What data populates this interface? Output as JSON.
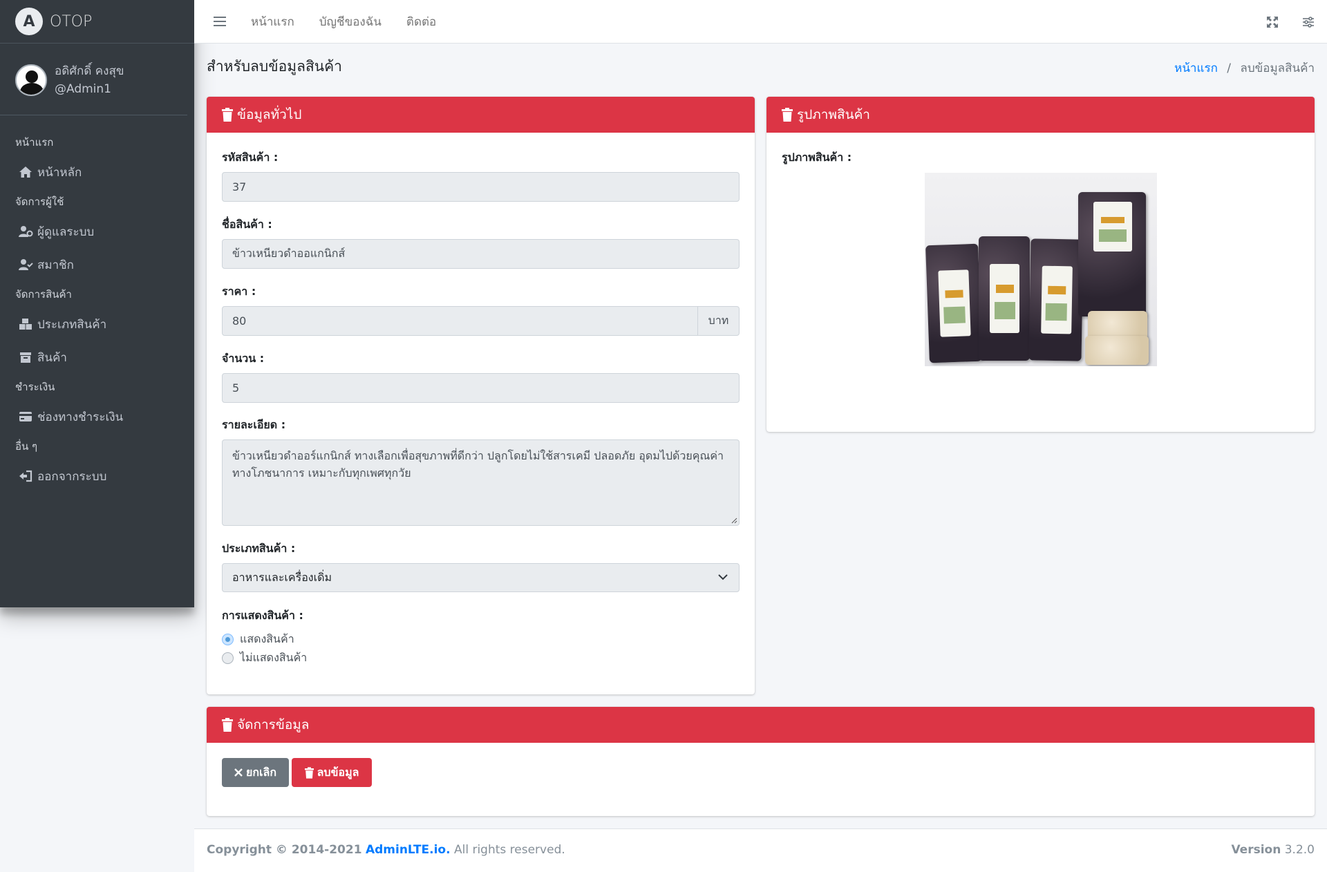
{
  "brand": {
    "logo_letter": "A",
    "name": "OTOP"
  },
  "user": {
    "name": "อดิศักดิ์ คงสุข",
    "handle": "@Admin1"
  },
  "sidebar": {
    "sections": [
      {
        "header": "หน้าแรก",
        "items": [
          {
            "label": "หน้าหลัก",
            "icon": "home-icon"
          }
        ]
      },
      {
        "header": "จัดการผู้ใช้",
        "items": [
          {
            "label": "ผู้ดูแลระบบ",
            "icon": "user-cog-icon"
          },
          {
            "label": "สมาชิก",
            "icon": "user-check-icon"
          }
        ]
      },
      {
        "header": "จัดการสินค้า",
        "items": [
          {
            "label": "ประเภทสินค้า",
            "icon": "boxes-icon"
          },
          {
            "label": "สินค้า",
            "icon": "archive-icon"
          }
        ]
      },
      {
        "header": "ชำระเงิน",
        "items": [
          {
            "label": "ช่องทางชำระเงิน",
            "icon": "credit-card-icon"
          }
        ]
      },
      {
        "header": "อื่น ๆ",
        "items": [
          {
            "label": "ออกจากระบบ",
            "icon": "sign-out-icon"
          }
        ]
      }
    ]
  },
  "topbar": {
    "links": [
      "หน้าแรก",
      "บัญชีของฉัน",
      "ติดต่อ"
    ]
  },
  "page": {
    "title": "สำหรับลบข้อมูลสินค้า",
    "breadcrumb_home": "หน้าแรก",
    "breadcrumb_sep": "/",
    "breadcrumb_current": "ลบข้อมูลสินค้า"
  },
  "general_card": {
    "title": "ข้อมูลทั่วไป",
    "code_label": "รหัสสินค้า :",
    "code_value": "37",
    "name_label": "ชื่อสินค้า :",
    "name_value": "ข้าวเหนียวดำออแกนิกส์",
    "price_label": "ราคา :",
    "price_value": "80",
    "price_unit": "บาท",
    "qty_label": "จำนวน :",
    "qty_value": "5",
    "detail_label": "รายละเอียด :",
    "detail_value": "ข้าวเหนียวดำออร์แกนิกส์ ทางเลือกเพื่อสุขภาพที่ดีกว่า ปลูกโดยไม่ใช้สารเคมี ปลอดภัย อุดมไปด้วยคุณค่าทางโภชนาการ เหมาะกับทุกเพศทุกวัย",
    "category_label": "ประเภทสินค้า :",
    "category_value": "อาหารและเครื่องเดิ่ม",
    "display_label": "การแสดงสินค้า :",
    "display_options": [
      "แสดงสินค้า",
      "ไม่แสดงสินค้า"
    ],
    "display_selected": 0
  },
  "image_card": {
    "title": "รูปภาพสินค้า",
    "label": "รูปภาพสินค้า :"
  },
  "manage_card": {
    "title": "จัดการข้อมูล",
    "cancel_label": "ยกเลิก",
    "delete_label": "ลบข้อมูล"
  },
  "footer": {
    "copyright": "Copyright © 2014-2021",
    "link": "AdminLTE.io.",
    "rights": "All rights reserved.",
    "version_label": "Version",
    "version": "3.2.0"
  },
  "colors": {
    "danger": "#dc3545",
    "sidebar": "#343a40",
    "link": "#007bff",
    "secondary": "#6c757d"
  }
}
